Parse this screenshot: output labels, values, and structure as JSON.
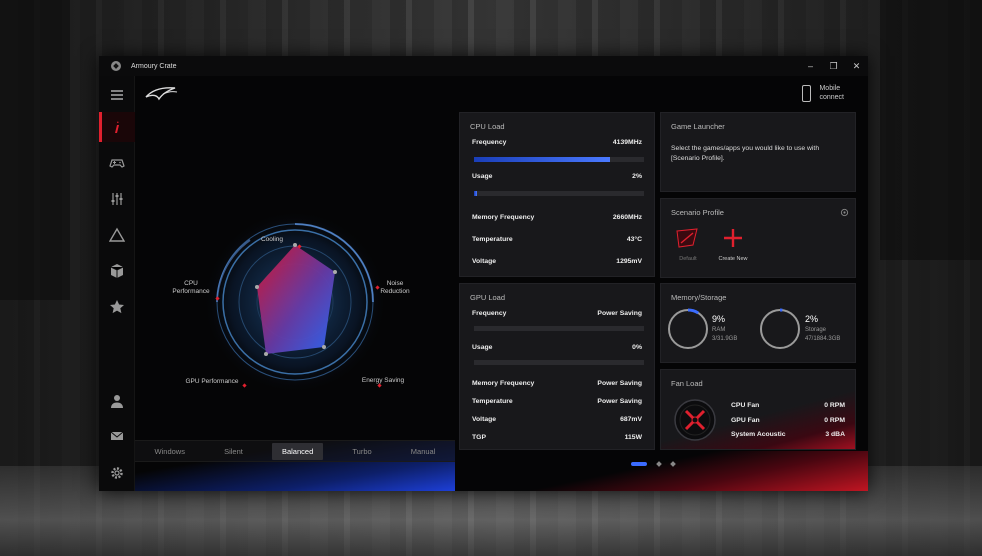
{
  "window": {
    "title": "Armoury Crate"
  },
  "topbar": {
    "mobile_line1": "Mobile",
    "mobile_line2": "connect"
  },
  "radar": {
    "labels": {
      "cooling": "Cooling",
      "noise_line1": "Noise",
      "noise_line2": "Reduction",
      "energy": "Energy Saving",
      "gpu": "GPU Performance",
      "cpu_line1": "CPU",
      "cpu_line2": "Performance"
    }
  },
  "modes": [
    {
      "label": "Windows",
      "active": false
    },
    {
      "label": "Silent",
      "active": false
    },
    {
      "label": "Balanced",
      "active": true
    },
    {
      "label": "Turbo",
      "active": false
    },
    {
      "label": "Manual",
      "active": false
    }
  ],
  "cpu_load": {
    "title": "CPU Load",
    "frequency_label": "Frequency",
    "frequency_value": "4139MHz",
    "frequency_fraction": 0.8,
    "usage_label": "Usage",
    "usage_value": "2%",
    "usage_fraction": 0.02,
    "memfreq_label": "Memory Frequency",
    "memfreq_value": "2660MHz",
    "temp_label": "Temperature",
    "temp_value": "43°C",
    "voltage_label": "Voltage",
    "voltage_value": "1295mV"
  },
  "gpu_load": {
    "title": "GPU Load",
    "frequency_label": "Frequency",
    "frequency_value": "Power Saving",
    "frequency_fraction": 0,
    "usage_label": "Usage",
    "usage_value": "0%",
    "usage_fraction": 0,
    "memfreq_label": "Memory Frequency",
    "memfreq_value": "Power Saving",
    "temp_label": "Temperature",
    "temp_value": "Power Saving",
    "voltage_label": "Voltage",
    "voltage_value": "687mV",
    "tgp_label": "TGP",
    "tgp_value": "115W"
  },
  "game_launcher": {
    "title": "Game Launcher",
    "text_line1": "Select the games/apps you would like to use with",
    "text_line2": "[Scenario Profile]."
  },
  "scenario": {
    "title": "Scenario Profile",
    "default_label": "Default",
    "create_label": "Create New"
  },
  "memory": {
    "title": "Memory/Storage",
    "ram_percent": "9%",
    "ram_label": "RAM",
    "ram_detail": "3/31.9GB",
    "ram_fraction": 0.09,
    "storage_percent": "2%",
    "storage_label": "Storage",
    "storage_detail": "47/1884.3GB",
    "storage_fraction": 0.02
  },
  "fan": {
    "title": "Fan Load",
    "cpu_label": "CPU Fan",
    "cpu_value": "0 RPM",
    "gpu_label": "GPU Fan",
    "gpu_value": "0 RPM",
    "acoustic_label": "System Acoustic",
    "acoustic_value": "3 dBA"
  },
  "colors": {
    "accent_red": "#e0202e",
    "accent_blue": "#3b6cff"
  }
}
